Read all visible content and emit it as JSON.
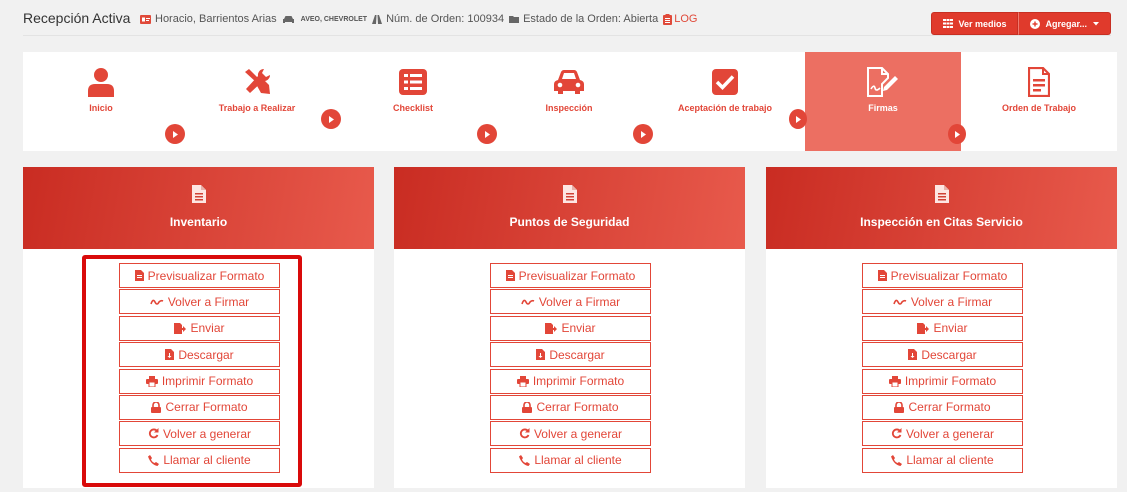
{
  "header": {
    "title": "Recepción Activa",
    "client": "Horacio, Barrientos Arias",
    "vehicle": "AVEO, CHEVROLET",
    "order_number": "Núm. de Orden: 100934",
    "order_status": "Estado de la Orden: Abierta",
    "log_label": "LOG",
    "buttons": {
      "ver_medios": "Ver medios",
      "agregar": "Agregar..."
    }
  },
  "steps": [
    {
      "label": "Inicio",
      "icon": "user-icon"
    },
    {
      "label": "Trabajo a Realizar",
      "icon": "tools-icon"
    },
    {
      "label": "Checklist",
      "icon": "list-icon"
    },
    {
      "label": "Inspección",
      "icon": "car-icon"
    },
    {
      "label": "Aceptación de trabajo",
      "icon": "check-square-icon"
    },
    {
      "label": "Firmas",
      "icon": "signature-doc-icon",
      "active": true
    },
    {
      "label": "Orden de Trabajo",
      "icon": "document-icon"
    }
  ],
  "cards": [
    {
      "title": "Inventario"
    },
    {
      "title": "Puntos de Seguridad"
    },
    {
      "title": "Inspección en Citas Servicio"
    }
  ],
  "actions": {
    "preview": "Previsualizar Formato",
    "resign": "Volver a Firmar",
    "send": "Enviar",
    "download": "Descargar",
    "print": "Imprimir Formato",
    "close": "Cerrar Formato",
    "regenerate": "Volver a generar",
    "call": "Llamar al cliente"
  },
  "colors": {
    "accent": "#e24638",
    "active_step": "#ec6f62",
    "highlight": "#d90a0a"
  }
}
